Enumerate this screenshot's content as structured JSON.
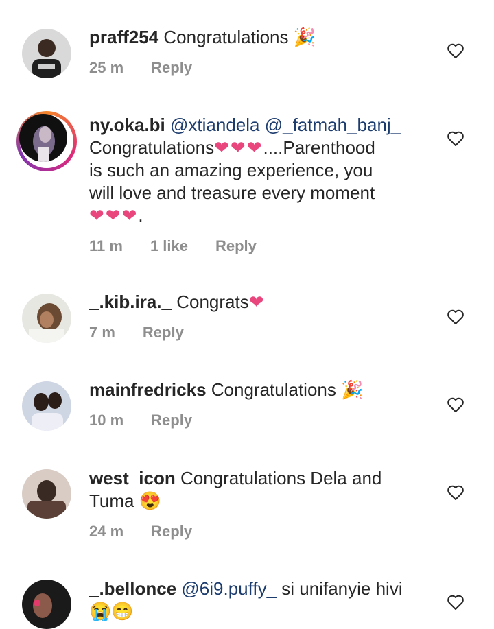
{
  "comments": [
    {
      "username": "praff254",
      "body": "Congratulations",
      "emoji": "🎉",
      "time": "25 m",
      "likes": "",
      "reply": "Reply"
    },
    {
      "username": "ny.oka.bi",
      "mention1": "@xtiandela",
      "mention2": "@_fatmah_banj_",
      "body_line1": "Congratulations",
      "body_hearts1": "❤❤❤",
      "body_cont": "....Parenthood",
      "body_line2": "is such an amazing experience, you",
      "body_line3": "will love and treasure every moment",
      "body_hearts2": "❤❤❤",
      "body_end": ".",
      "time": "11 m",
      "likes": "1 like",
      "reply": "Reply"
    },
    {
      "username": "_.kib.ira._",
      "body": "Congrats",
      "emoji": "❤",
      "time": "7 m",
      "reply": "Reply"
    },
    {
      "username": "mainfredricks",
      "body": "Congratulations",
      "emoji": "🎉",
      "time": "10 m",
      "reply": "Reply"
    },
    {
      "username": "west_icon",
      "body": "Congratulations Dela and",
      "body_line2": "Tuma",
      "emoji": "😍",
      "time": "24 m",
      "reply": "Reply"
    },
    {
      "username": "_.bellonce",
      "mention": "@6i9.puffy_",
      "body": "si unifanyie hivi",
      "emoji": "😭😁"
    }
  ],
  "colors": {
    "text": "#262626",
    "meta": "#8e8e8e",
    "mention": "#1c3c6e",
    "heart_emoji": "#e8467c"
  }
}
